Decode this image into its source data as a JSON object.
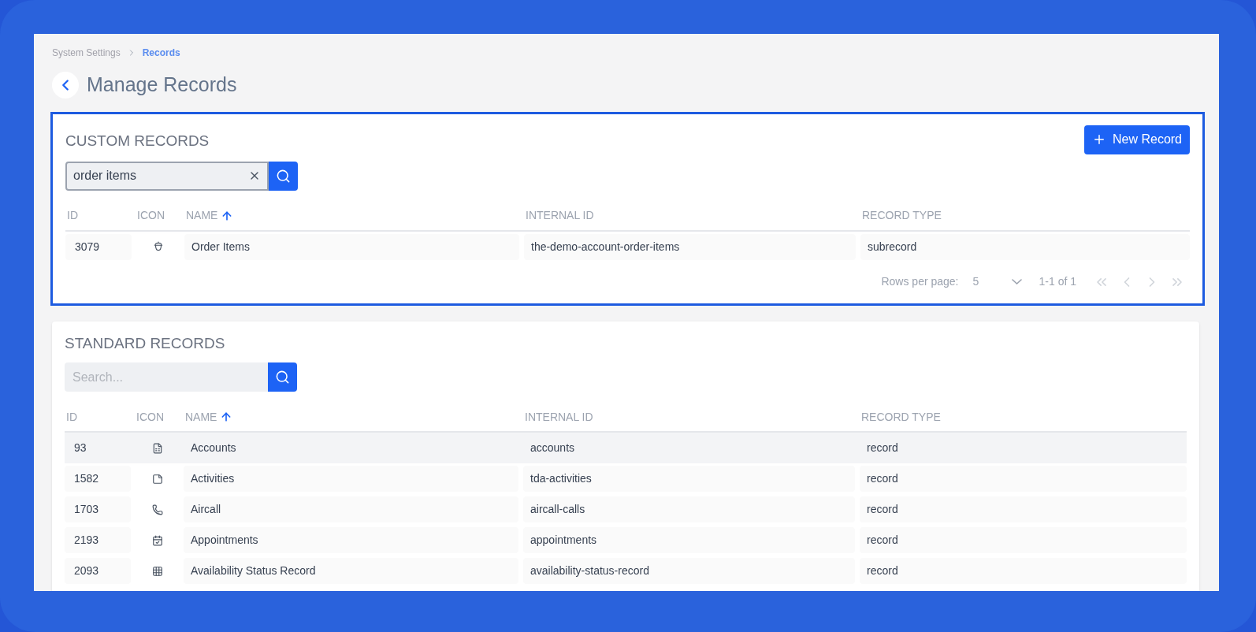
{
  "breadcrumb": [
    {
      "label": "System Settings",
      "selected": false
    },
    {
      "label": "Records",
      "selected": true
    }
  ],
  "page_title": "Manage Records",
  "custom_records": {
    "title": "CUSTOM RECORDS",
    "new_button": "New Record",
    "search": {
      "value": "order items"
    },
    "columns": [
      {
        "label": "ID",
        "sorted": false
      },
      {
        "label": "ICON",
        "sorted": false
      },
      {
        "label": "NAME",
        "sorted": true
      },
      {
        "label": "INTERNAL ID",
        "sorted": false
      },
      {
        "label": "RECORD TYPE",
        "sorted": false
      }
    ],
    "rows": [
      {
        "id": "3079",
        "name": "Order Items",
        "internal_id": "the-demo-account-order-items",
        "record_type": "subrecord",
        "selected": false
      }
    ],
    "pagination": {
      "rows_per_page_label": "Rows per page:",
      "rows_per_page": "5",
      "range": "1-1 of 1"
    }
  },
  "standard_records": {
    "title": "STANDARD RECORDS",
    "search": {
      "placeholder": "Search..."
    },
    "columns": [
      {
        "label": "ID",
        "sorted": false
      },
      {
        "label": "ICON",
        "sorted": false
      },
      {
        "label": "NAME",
        "sorted": true
      },
      {
        "label": "INTERNAL ID",
        "sorted": false
      },
      {
        "label": "RECORD TYPE",
        "sorted": false
      }
    ],
    "rows": [
      {
        "id": "93",
        "name": "Accounts",
        "internal_id": "accounts",
        "record_type": "record",
        "selected": true
      },
      {
        "id": "1582",
        "name": "Activities",
        "internal_id": "tda-activities",
        "record_type": "record",
        "selected": false
      },
      {
        "id": "1703",
        "name": "Aircall",
        "internal_id": "aircall-calls",
        "record_type": "record",
        "selected": false
      },
      {
        "id": "2193",
        "name": "Appointments",
        "internal_id": "appointments",
        "record_type": "record",
        "selected": false
      },
      {
        "id": "2093",
        "name": "Availability Status Record",
        "internal_id": "availability-status-record",
        "record_type": "record",
        "selected": false
      }
    ]
  }
}
